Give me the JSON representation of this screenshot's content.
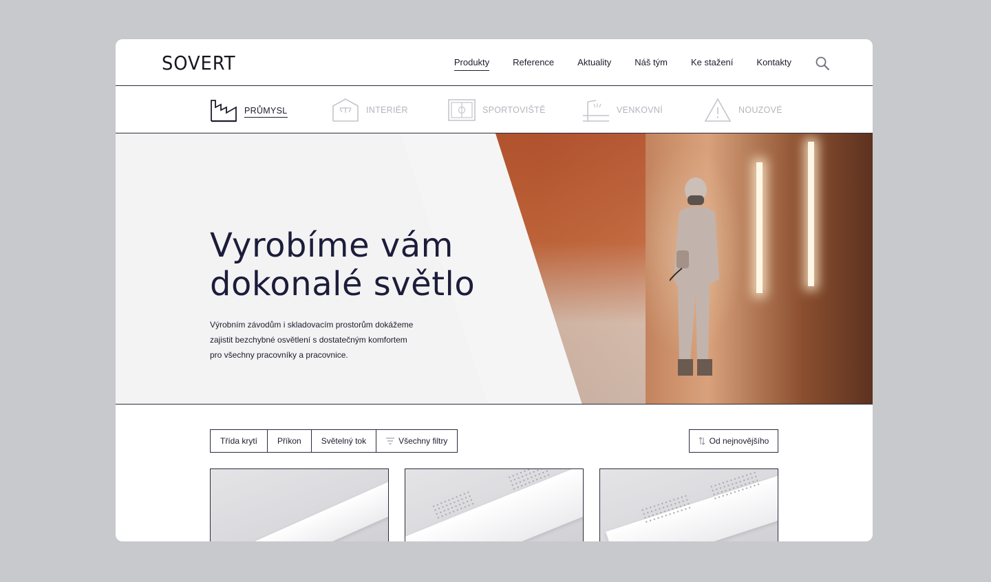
{
  "brand": {
    "logo_text": "SOVERT"
  },
  "nav": {
    "items": [
      {
        "label": "Produkty",
        "active": true
      },
      {
        "label": "Reference",
        "active": false
      },
      {
        "label": "Aktuality",
        "active": false
      },
      {
        "label": "Náš tým",
        "active": false
      },
      {
        "label": "Ke stažení",
        "active": false
      },
      {
        "label": "Kontakty",
        "active": false
      }
    ],
    "search_icon": "search-icon"
  },
  "categories": [
    {
      "label": "PRŮMYSL",
      "icon": "factory-icon",
      "active": true
    },
    {
      "label": "INTERIÉR",
      "icon": "warehouse-icon",
      "active": false
    },
    {
      "label": "SPORTOVIŠTĚ",
      "icon": "stadium-icon",
      "active": false
    },
    {
      "label": "VENKOVNÍ",
      "icon": "streetlight-icon",
      "active": false
    },
    {
      "label": "NOUZOVÉ",
      "icon": "warning-icon",
      "active": false
    }
  ],
  "hero": {
    "title_line1": "Vyrobíme vám",
    "title_line2": "dokonalé světlo",
    "text_line1": "Výrobním závodům i skladovacím prostorům dokážeme",
    "text_line2": "zajistit bezchybné osvětlení s dostatečným komfortem",
    "text_line3": "pro všechny pracovníky a pracovnice."
  },
  "filters": {
    "items": [
      "Třída krytí",
      "Příkon",
      "Světelný tok",
      "Všechny filtry"
    ],
    "sort_label": "Od nejnovějšího"
  },
  "colors": {
    "text": "#1c1c2e",
    "muted": "#b4b4bc",
    "border": "#2a2a3a",
    "hero_bg": "#f3f3f4"
  }
}
